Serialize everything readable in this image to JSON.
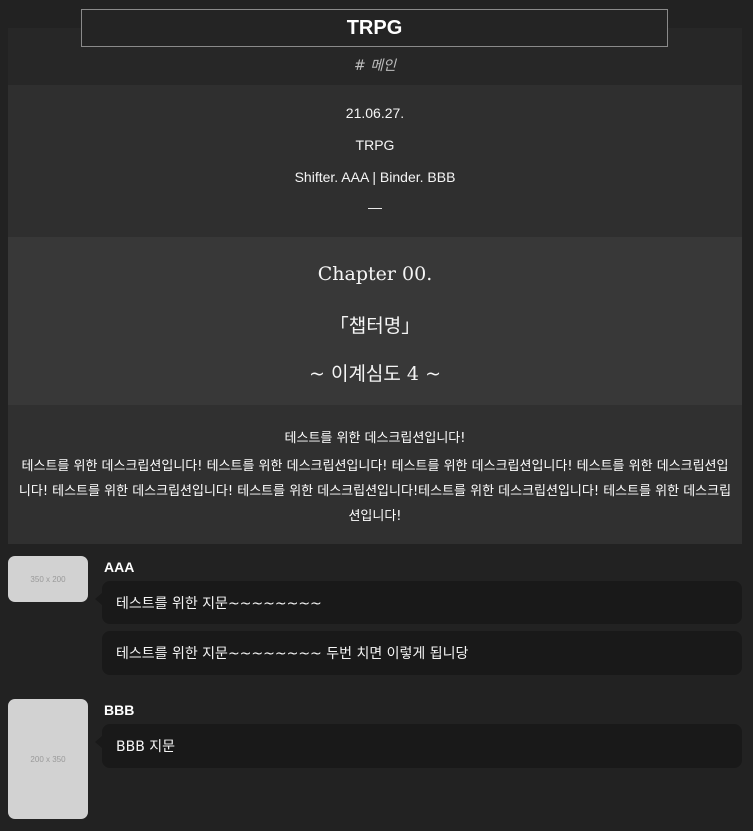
{
  "header": {
    "title": "TRPG",
    "tag": "# 메인"
  },
  "info": {
    "date": "21.06.27.",
    "game": "TRPG",
    "players": "Shifter. AAA | Binder. BBB",
    "divider": "—"
  },
  "chapter": {
    "number": "Chapter 00.",
    "name": "「챕터명」",
    "depth": "~ 이계심도 4 ~"
  },
  "description": {
    "short": "테스트를 위한 데스크립션입니다!",
    "long": "테스트를 위한 데스크립션입니다! 테스트를 위한 데스크립션입니다! 테스트를 위한 데스크립션입니다! 테스트를 위한 데스크립션입니다! 테스트를 위한 데스크립션입니다! 테스트를 위한 데스크립션입니다!테스트를 위한 데스크립션입니다! 테스트를 위한 데스크립션입니다!"
  },
  "messages": [
    {
      "speaker": "AAA",
      "avatar_text": "350 x 200",
      "lines": [
        "테스트를 위한 지문~~~~~~~~",
        "테스트를 위한 지문~~~~~~~~ 두번 치면 이렇게 됩니당"
      ]
    },
    {
      "speaker": "BBB",
      "avatar_text": "200 x 350",
      "lines": [
        "BBB 지문"
      ]
    }
  ]
}
